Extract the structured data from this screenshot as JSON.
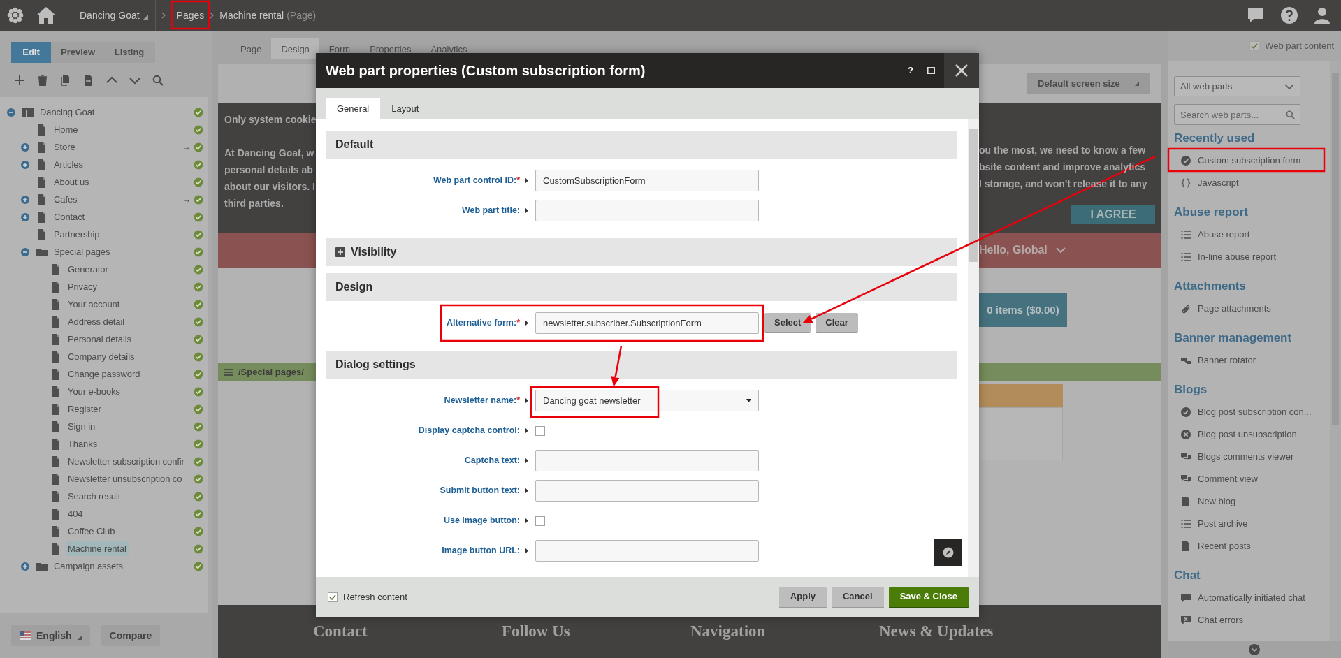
{
  "top_bar": {
    "breadcrumbs": [
      {
        "label": "Dancing Goat",
        "kind": "site",
        "highlighted": false
      },
      {
        "label": "Pages",
        "kind": "link",
        "highlighted": true
      },
      {
        "label": "Machine rental",
        "kind": "current",
        "note": "(Page)",
        "highlighted": false
      }
    ]
  },
  "edit_modes": [
    {
      "label": "Edit",
      "selected": true
    },
    {
      "label": "Preview",
      "selected": false
    },
    {
      "label": "Listing",
      "selected": false
    }
  ],
  "tree": [
    {
      "label": "Dancing Goat",
      "kind": "site",
      "expanded": true,
      "selected": false,
      "children": [
        {
          "label": "Home",
          "kind": "page",
          "selected": false
        },
        {
          "label": "Store",
          "kind": "page",
          "expanded": false,
          "selected": false,
          "link_mark": "→"
        },
        {
          "label": "Articles",
          "kind": "page",
          "expanded": false,
          "selected": false
        },
        {
          "label": "About us",
          "kind": "page",
          "selected": false
        },
        {
          "label": "Cafes",
          "kind": "page",
          "expanded": false,
          "selected": false,
          "link_mark": "→"
        },
        {
          "label": "Contact",
          "kind": "page",
          "expanded": false,
          "selected": false
        },
        {
          "label": "Partnership",
          "kind": "page",
          "selected": false
        },
        {
          "label": "Special pages",
          "kind": "folder",
          "expanded": true,
          "selected": false,
          "children": [
            {
              "label": "Generator",
              "kind": "page",
              "selected": false
            },
            {
              "label": "Privacy",
              "kind": "page",
              "selected": false
            },
            {
              "label": "Your account",
              "kind": "page",
              "selected": false
            },
            {
              "label": "Address detail",
              "kind": "page",
              "selected": false
            },
            {
              "label": "Personal details",
              "kind": "page",
              "selected": false
            },
            {
              "label": "Company details",
              "kind": "page",
              "selected": false
            },
            {
              "label": "Change password",
              "kind": "page",
              "selected": false
            },
            {
              "label": "Your e-books",
              "kind": "page",
              "selected": false
            },
            {
              "label": "Register",
              "kind": "page",
              "selected": false
            },
            {
              "label": "Sign in",
              "kind": "page",
              "selected": false
            },
            {
              "label": "Thanks",
              "kind": "page",
              "selected": false
            },
            {
              "label": "Newsletter subscription confir",
              "kind": "page",
              "selected": false
            },
            {
              "label": "Newsletter unsubscription co",
              "kind": "page",
              "selected": false
            },
            {
              "label": "Search result",
              "kind": "page",
              "selected": false
            },
            {
              "label": "404",
              "kind": "page",
              "selected": false
            },
            {
              "label": "Coffee Club",
              "kind": "page",
              "selected": false
            },
            {
              "label": "Machine rental",
              "kind": "page",
              "selected": true
            }
          ]
        },
        {
          "label": "Campaign assets",
          "kind": "folder",
          "expanded": false,
          "selected": false
        }
      ]
    }
  ],
  "language": "English",
  "compare_button": "Compare",
  "page_tabs": [
    {
      "label": "Page",
      "selected": false
    },
    {
      "label": "Design",
      "selected": true
    },
    {
      "label": "Form",
      "selected": false
    },
    {
      "label": "Properties",
      "selected": false
    },
    {
      "label": "Analytics",
      "selected": false
    }
  ],
  "screen_size": "Default screen size",
  "page_preview": {
    "cookie_paragraphs": [
      [
        {
          "left": "Only system cookie"
        }
      ],
      [
        {
          "left": "At Dancing Goat, w",
          "right": "ou the most, we need to know a few"
        },
        {
          "left": "personal details ab",
          "right": "bsite content and improve analytics"
        },
        {
          "left": "about our visitors. I",
          "right": "l storage, and won't release it to any"
        },
        {
          "left": "third parties."
        }
      ]
    ],
    "agree_button": "I AGREE",
    "greeting": "Hello, Global",
    "cart_button": "0 items ($0.00)",
    "zone_path": "/Special pages/",
    "footer_headings": [
      "Contact",
      "Follow Us",
      "Navigation",
      "News & Updates"
    ]
  },
  "dialog": {
    "title": "Web part properties (Custom subscription form)",
    "help_label": "?",
    "tabs": [
      {
        "label": "General",
        "selected": true
      },
      {
        "label": "Layout",
        "selected": false
      }
    ],
    "sections": [
      {
        "title": "Default",
        "fields": [
          {
            "label": "Web part control ID:",
            "required_mark": "*",
            "kind": "text",
            "value": "CustomSubscriptionForm",
            "highlighted": false
          },
          {
            "label": "Web part title:",
            "kind": "text",
            "highlighted": false
          }
        ]
      },
      {
        "title": "Visibility",
        "expanded": false
      },
      {
        "title": "Design",
        "fields": [
          {
            "label": "Alternative form:",
            "required_mark": "*",
            "kind": "text",
            "value": "newsletter.subscriber.SubscriptionForm",
            "buttons": [
              "Select",
              "Clear"
            ],
            "highlighted": true
          }
        ]
      },
      {
        "title": "Dialog settings",
        "fields": [
          {
            "label": "Newsletter name:",
            "required_mark": "*",
            "kind": "select",
            "value": "Dancing goat newsletter",
            "highlighted": true
          },
          {
            "label": "Display captcha control:",
            "kind": "checkbox",
            "checked": false,
            "highlighted": false
          },
          {
            "label": "Captcha text:",
            "kind": "text",
            "highlighted": false
          },
          {
            "label": "Submit button text:",
            "kind": "text",
            "highlighted": false
          },
          {
            "label": "Use image button:",
            "kind": "checkbox",
            "checked": false,
            "highlighted": false
          },
          {
            "label": "Image button URL:",
            "kind": "text",
            "highlighted": false
          }
        ]
      }
    ],
    "refresh": {
      "label": "Refresh content",
      "checked": true
    },
    "buttons": [
      {
        "label": "Apply",
        "kind": "secondary"
      },
      {
        "label": "Cancel",
        "kind": "secondary"
      },
      {
        "label": "Save & Close",
        "kind": "primary"
      }
    ]
  },
  "web_parts_panel": {
    "content_toggle": {
      "label": "Web part content",
      "checked": true
    },
    "filter": "All web parts",
    "search_placeholder": "Search web parts...",
    "categories": [
      {
        "title": "Recently used",
        "items": [
          {
            "label": "Custom subscription form",
            "kind": "form",
            "highlighted": true
          },
          {
            "label": "Javascript",
            "kind": "script",
            "highlighted": false
          }
        ]
      },
      {
        "title": "Abuse report",
        "items": [
          {
            "label": "Abuse report",
            "kind": "list",
            "highlighted": false
          },
          {
            "label": "In-line abuse report",
            "kind": "list",
            "highlighted": false
          }
        ]
      },
      {
        "title": "Attachments",
        "items": [
          {
            "label": "Page attachments",
            "kind": "attachment",
            "highlighted": false
          }
        ]
      },
      {
        "title": "Banner management",
        "items": [
          {
            "label": "Banner rotator",
            "kind": "banner",
            "highlighted": false
          }
        ]
      },
      {
        "title": "Blogs",
        "items": [
          {
            "label": "Blog post subscription con...",
            "kind": "form",
            "highlighted": false
          },
          {
            "label": "Blog post unsubscription",
            "kind": "unsubscribe",
            "highlighted": false
          },
          {
            "label": "Blogs comments viewer",
            "kind": "comments",
            "highlighted": false
          },
          {
            "label": "Comment view",
            "kind": "comments",
            "highlighted": false
          },
          {
            "label": "New blog",
            "kind": "document",
            "highlighted": false
          },
          {
            "label": "Post archive",
            "kind": "list",
            "highlighted": false
          },
          {
            "label": "Recent posts",
            "kind": "document",
            "highlighted": false
          }
        ]
      },
      {
        "title": "Chat",
        "items": [
          {
            "label": "Automatically initiated chat",
            "kind": "chat",
            "highlighted": false
          },
          {
            "label": "Chat errors",
            "kind": "error",
            "highlighted": false
          }
        ]
      }
    ]
  }
}
